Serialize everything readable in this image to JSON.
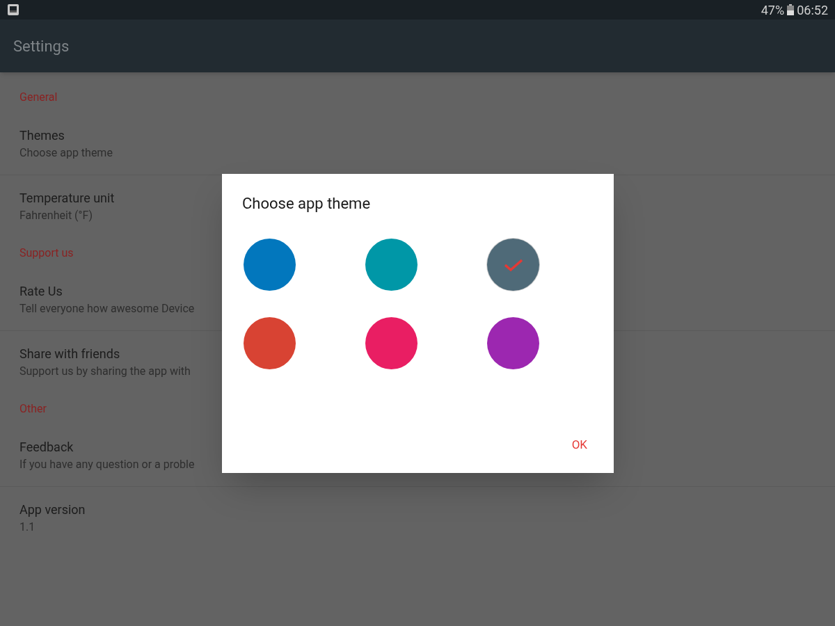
{
  "status_bar": {
    "battery": "47%",
    "time": "06:52"
  },
  "toolbar": {
    "title": "Settings"
  },
  "sections": [
    {
      "header": "General",
      "items": [
        {
          "title": "Themes",
          "summary": "Choose app theme"
        },
        {
          "title": "Temperature unit",
          "summary": "Fahrenheit (°F)"
        }
      ]
    },
    {
      "header": "Support us",
      "items": [
        {
          "title": "Rate Us",
          "summary": "Tell everyone how awesome Device"
        },
        {
          "title": "Share with friends",
          "summary": "Support us by sharing the app with"
        }
      ]
    },
    {
      "header": "Other",
      "items": [
        {
          "title": "Feedback",
          "summary": "If you have any question or a proble"
        },
        {
          "title": "App version",
          "summary": "1.1"
        }
      ]
    }
  ],
  "dialog": {
    "title": "Choose app theme",
    "themes": [
      {
        "color": "#0277bd",
        "selected": false
      },
      {
        "color": "#0097a7",
        "selected": false
      },
      {
        "color": "#4f6a78",
        "selected": true
      },
      {
        "color": "#d84333",
        "selected": false
      },
      {
        "color": "#e91e63",
        "selected": false
      },
      {
        "color": "#9c27b0",
        "selected": false
      }
    ],
    "button": "OK"
  }
}
